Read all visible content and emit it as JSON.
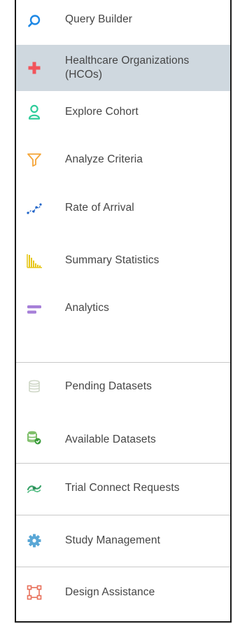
{
  "nav": {
    "items": [
      {
        "label": "Query Builder",
        "icon": "search-icon",
        "color": "#1e88e5"
      },
      {
        "label": "Healthcare Organizations (HCOs)",
        "icon": "plus-icon",
        "color": "#f2545b",
        "active": true
      },
      {
        "label": "Explore Cohort",
        "icon": "person-icon",
        "color": "#2ecc9a"
      },
      {
        "label": "Analyze Criteria",
        "icon": "funnel-icon",
        "color": "#f5a63a"
      },
      {
        "label": "Rate of Arrival",
        "icon": "trend-line-icon",
        "color": "#1e63c8"
      },
      {
        "label": "Summary Statistics",
        "icon": "bar-chart-icon",
        "color": "#e6c619"
      },
      {
        "label": "Analytics",
        "icon": "bars-icon",
        "color": "#a67fd8"
      },
      {
        "label": "Pending Datasets",
        "icon": "database-icon",
        "color": "#cfd7c7"
      },
      {
        "label": "Available Datasets",
        "icon": "database-check-icon",
        "color": "#7fbf6a"
      },
      {
        "label": "Trial Connect Requests",
        "icon": "trial-connect-icon",
        "color": "#3aa36a"
      },
      {
        "label": "Study Management",
        "icon": "gear-icon",
        "color": "#5aa7d6"
      },
      {
        "label": "Design Assistance",
        "icon": "design-icon",
        "color": "#e8705a"
      }
    ]
  }
}
